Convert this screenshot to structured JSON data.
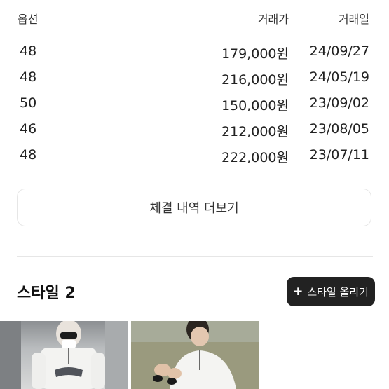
{
  "trades": {
    "headers": {
      "option": "옵션",
      "price": "거래가",
      "date": "거래일"
    },
    "rows": [
      {
        "option": "48",
        "price": "179,000원",
        "date": "24/09/27"
      },
      {
        "option": "48",
        "price": "216,000원",
        "date": "24/05/19"
      },
      {
        "option": "50",
        "price": "150,000원",
        "date": "23/09/02"
      },
      {
        "option": "46",
        "price": "212,000원",
        "date": "23/08/05"
      },
      {
        "option": "48",
        "price": "222,000원",
        "date": "23/07/11"
      }
    ],
    "more_label": "체결 내역 더보기"
  },
  "style": {
    "title": "스타일 2",
    "upload_plus": "+",
    "upload_label": "스타일 올리기"
  },
  "colors": {
    "accent": "#222222",
    "border": "#e6e6e6"
  }
}
